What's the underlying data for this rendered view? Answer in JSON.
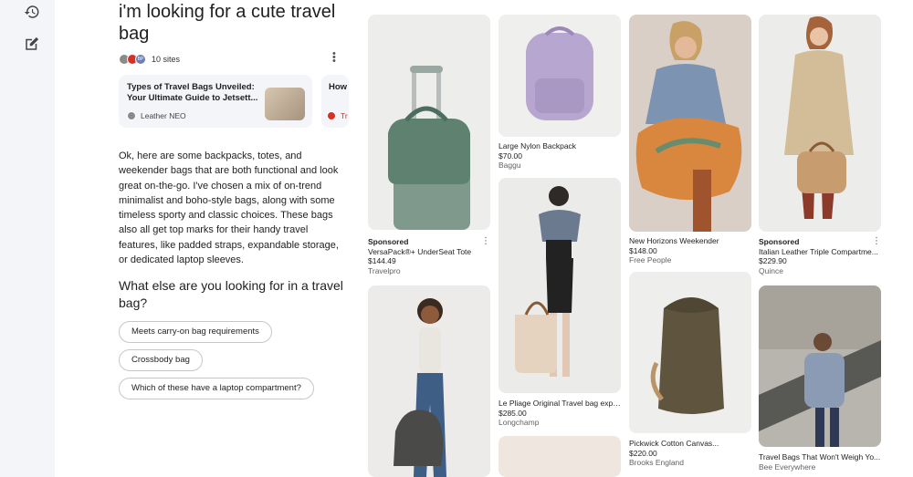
{
  "sidebar": {
    "history_icon": "history-icon",
    "new_chat_icon": "edit-icon"
  },
  "query": {
    "title": "i'm looking for a cute travel bag"
  },
  "sources": {
    "count_label": "10 sites",
    "favicon_colors": [
      "#8a8a8a",
      "#d93025",
      "#6f7fb6"
    ],
    "favicon_initials": [
      "",
      "",
      "BP"
    ],
    "cards": [
      {
        "title": "Types of Travel Bags Unveiled: Your Ultimate Guide to Jetsett...",
        "source": "Leather NEO"
      },
      {
        "title": "How Feat...",
        "source": "Tr"
      }
    ]
  },
  "answer": {
    "paragraph": "Ok, here are some backpacks, totes, and weekender bags that are both functional and look great on-the-go. I've chosen a mix of on-trend minimalist and boho-style bags, along with some timeless sporty and classic choices. These bags also all get top marks for their handy travel features, like padded straps, expandable storage, or dedicated laptop sleeves.",
    "followup_question": "What else are you looking for in a travel bag?",
    "suggestions": [
      "Meets carry-on bag requirements",
      "Crossbody bag",
      "Which of these have a laptop compartment?"
    ]
  },
  "products": [
    {
      "sponsored": "Sponsored",
      "name": "VersaPack®+ UnderSeat Tote",
      "price": "$144.49",
      "store": "Travelpro"
    },
    {
      "sponsored": "",
      "name": "Large Nylon Backpack",
      "price": "$70.00",
      "store": "Baggu"
    },
    {
      "sponsored": "",
      "name": "New Horizons Weekender",
      "price": "$148.00",
      "store": "Free People"
    },
    {
      "sponsored": "Sponsored",
      "name": "Italian Leather Triple Compartme...",
      "price": "$229.90",
      "store": "Quince"
    },
    {
      "sponsored": "",
      "name": "Le Pliage Original Travel bag expa...",
      "price": "$285.00",
      "store": "Longchamp"
    },
    {
      "sponsored": "",
      "name": "Pickwick Cotton Canvas...",
      "price": "$220.00",
      "store": "Brooks England"
    },
    {
      "sponsored": "",
      "name": "Travel Bags That Won't Weigh Yo...",
      "price": "",
      "store": "Bee Everywhere"
    }
  ],
  "colors": {
    "chip_border": "#c7c7c7",
    "rail_bg": "#f3f5f8",
    "card_bg": "#f3f5f8",
    "muted_text": "#5f6368"
  }
}
